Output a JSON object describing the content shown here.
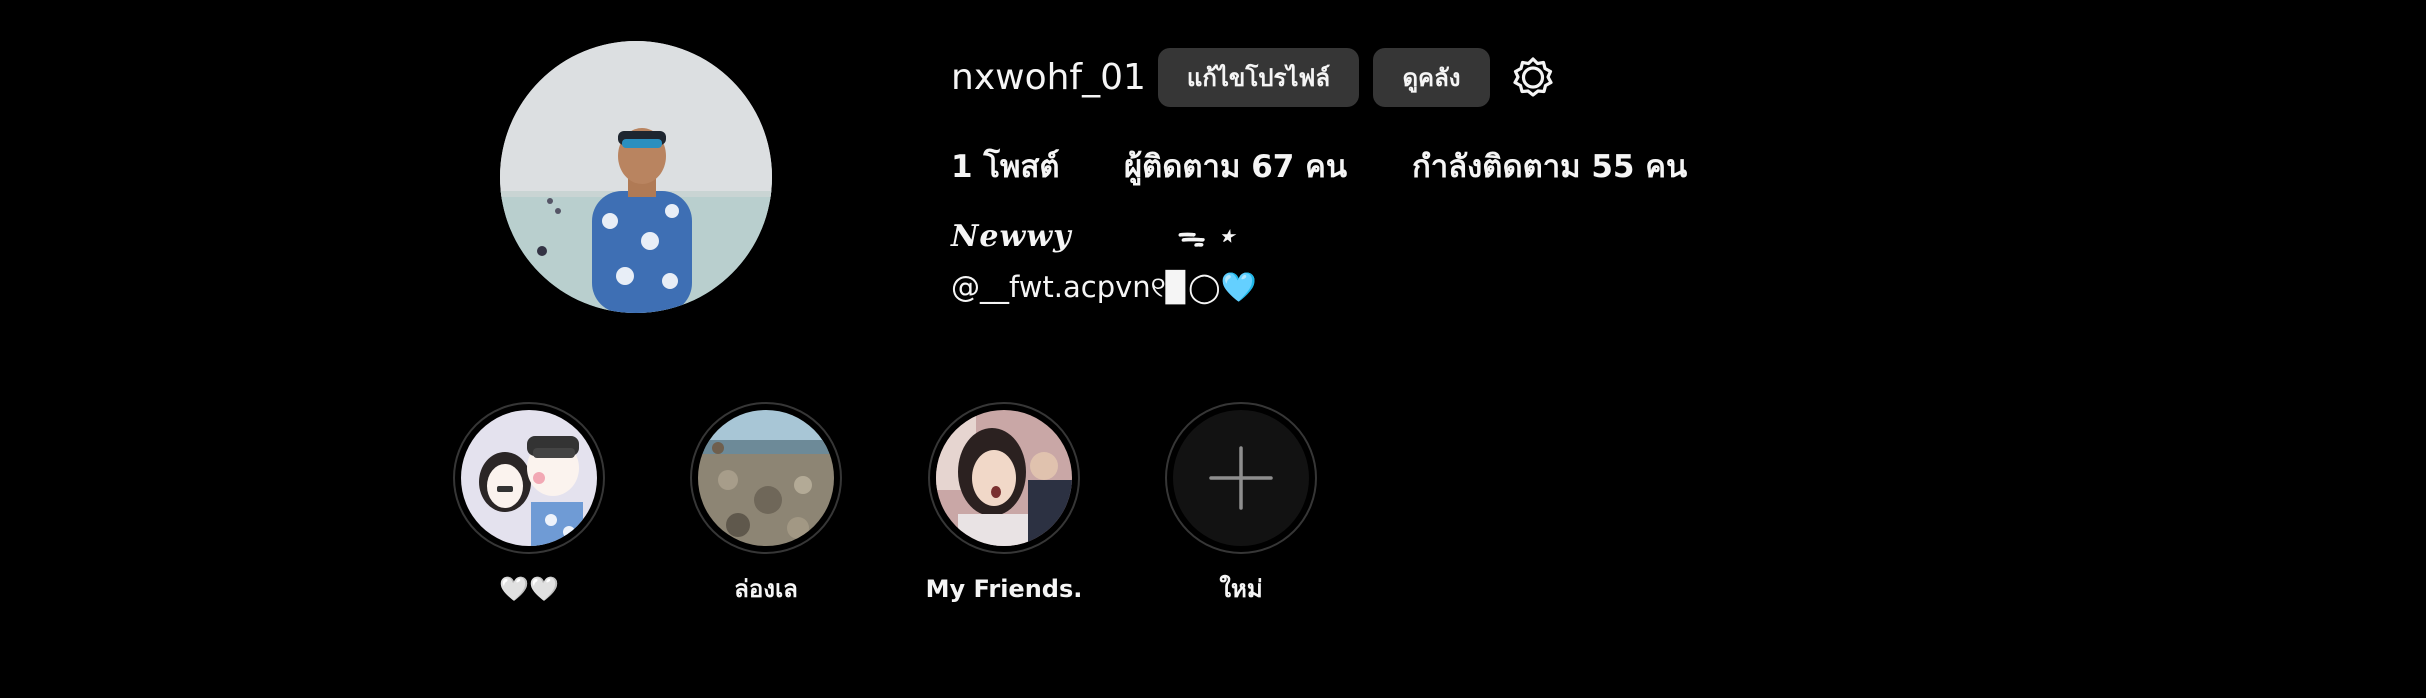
{
  "profile": {
    "username": "nxwohf_01",
    "edit_profile_label": "แก้ไขโปรไฟล์",
    "view_archive_label": "ดูคลัง",
    "settings_icon": "gear-icon"
  },
  "stats": {
    "posts": "1 โพสต์",
    "followers": "ผู้ติดตาม 67 คน",
    "following": "กำลังติดตาม 55 คน"
  },
  "bio": {
    "name": "𝑵𝒆𝒘𝒘𝒚         ᯓ ⋆",
    "line": "@__fwt.acpvn୧▉◯🩵"
  },
  "highlights": [
    {
      "label": "🤍🤍"
    },
    {
      "label": "ล่องเล"
    },
    {
      "label": "My Friends."
    },
    {
      "label": "ใหม่"
    }
  ]
}
